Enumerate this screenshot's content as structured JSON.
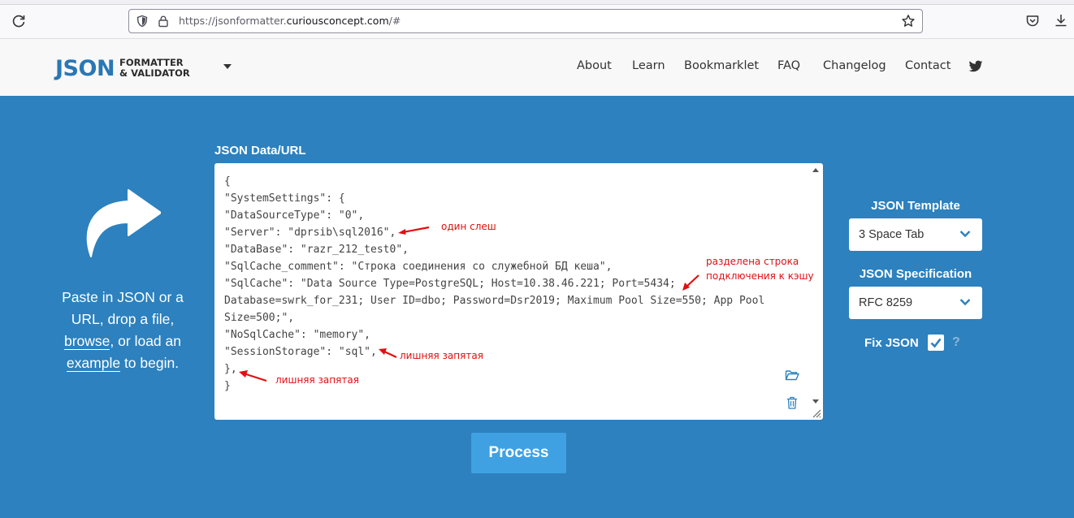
{
  "browser": {
    "url_prefix": "https://jsonformatter.",
    "url_domain": "curiousconcept.com",
    "url_suffix": "/#"
  },
  "header": {
    "logo_main": "JSON",
    "logo_line1": "FORMATTER",
    "logo_line2": "& VALIDATOR",
    "nav": [
      "About",
      "Learn",
      "Bookmarklet",
      "FAQ",
      "Changelog",
      "Contact"
    ]
  },
  "intro": {
    "part1": "Paste in JSON or a URL, drop a file, ",
    "browse": "browse",
    "part2": ", or load an ",
    "example": "example",
    "part3": " to begin."
  },
  "editor": {
    "label": "JSON Data/URL",
    "lines": [
      "{",
      "\"SystemSettings\": {",
      "\"DataSourceType\": \"0\",",
      "\"Server\": \"dprsib\\sql2016\",",
      "\"DataBase\": \"razr_212_test0\",",
      "\"SqlCache_comment\": \"Строка соединения со служебной БД кеша\",",
      "\"SqlCache\": \"Data Source Type=PostgreSQL; Host=10.38.46.221; Port=5434;",
      "Database=swrk_for_231; User ID=dbo; Password=Dsr2019; Maximum Pool Size=550; App Pool",
      "Size=500;\",",
      "\"NoSqlCache\": \"memory\",",
      "\"SessionStorage\": \"sql\",",
      "},",
      "}"
    ]
  },
  "annotations": {
    "single_slash": "один слеш",
    "split_line_1": "разделена строка",
    "split_line_2": "подключения к кэшу",
    "extra_comma_1": "лишняя запятая",
    "extra_comma_2": "лишняя запятая",
    "color": "#e01010"
  },
  "process_button": "Process",
  "options": {
    "template_label": "JSON Template",
    "template_value": "3 Space Tab",
    "spec_label": "JSON Specification",
    "spec_value": "RFC 8259",
    "fix_label": "Fix JSON",
    "fix_checked": true,
    "help": "?"
  },
  "colors": {
    "background": "#2c81be",
    "button": "#3fa1e2",
    "logo": "#2a77b4"
  }
}
